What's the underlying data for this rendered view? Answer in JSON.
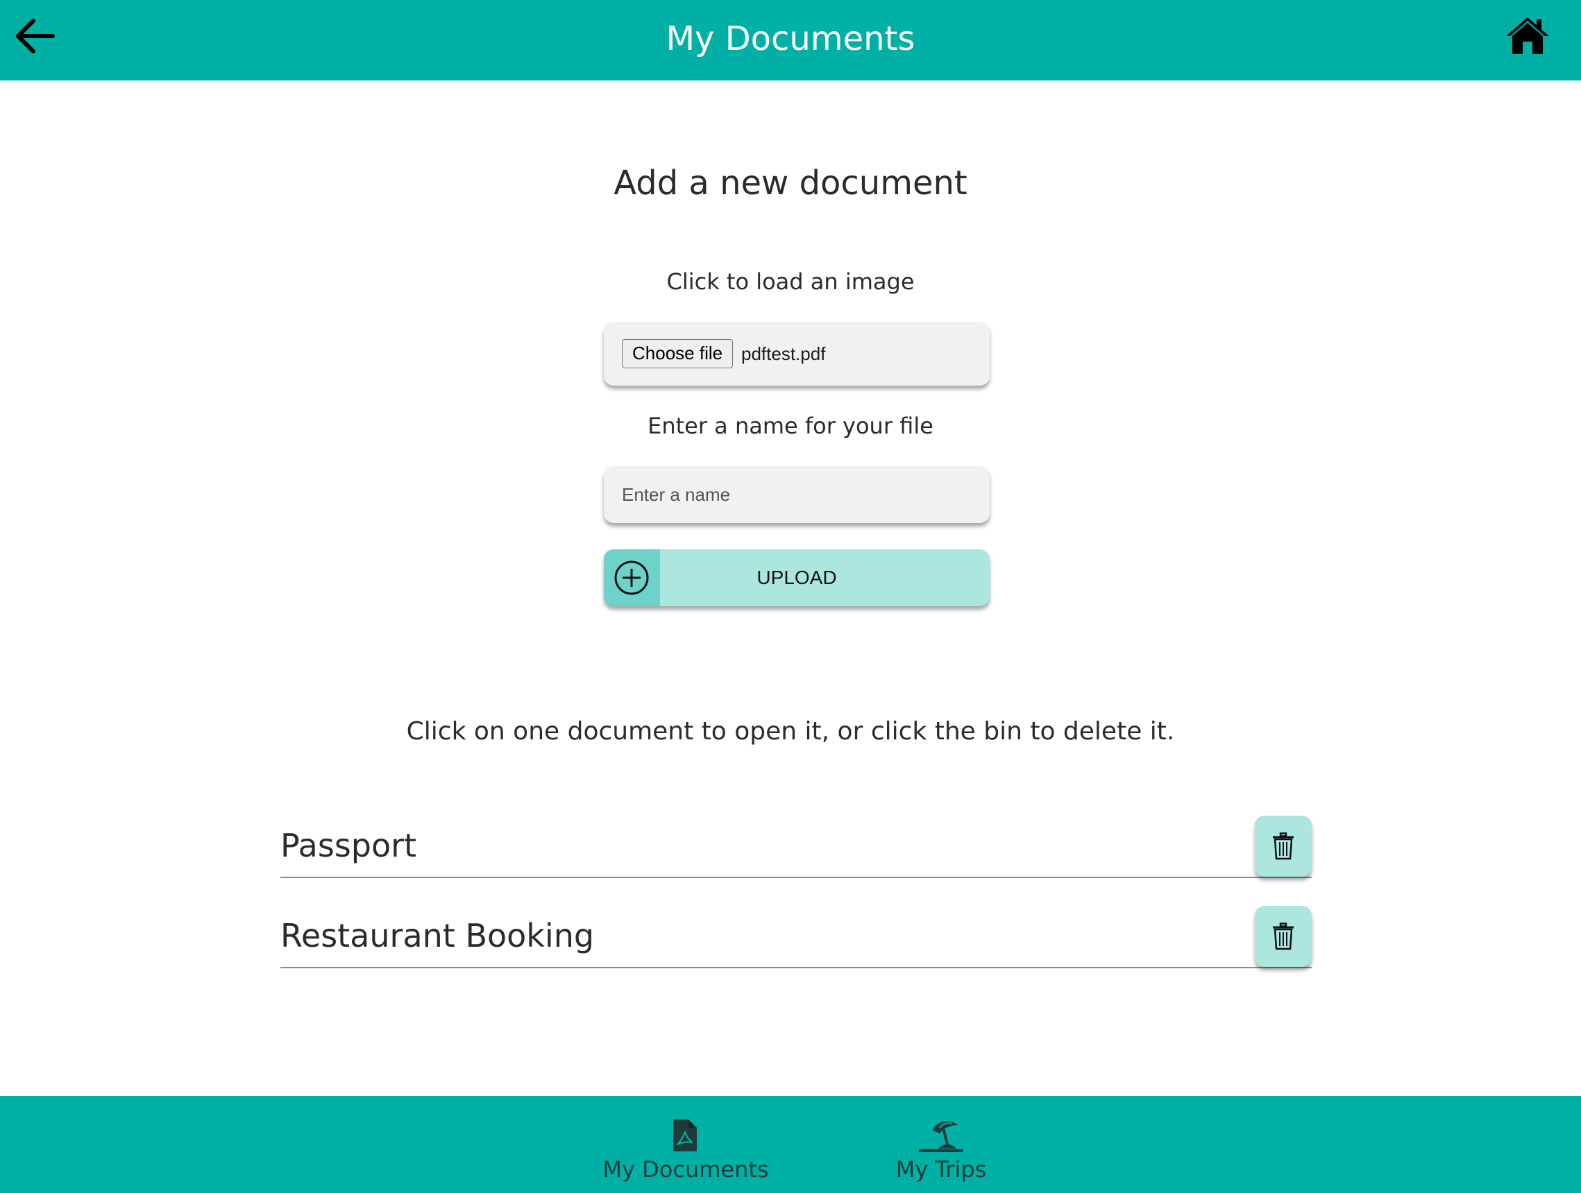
{
  "header": {
    "title": "My Documents",
    "back_icon": "arrow-left-icon",
    "home_icon": "home-icon",
    "background": "#00b0a4"
  },
  "form": {
    "heading": "Add a new document",
    "load_label": "Click to load an image",
    "choose_file_label": "Choose file",
    "selected_file": "pdftest.pdf",
    "name_label": "Enter a name for your file",
    "name_value": "",
    "name_placeholder": "Enter a name",
    "upload_label": "UPLOAD",
    "upload_icon": "plus-circle-icon",
    "accent_light": "#abe6df",
    "accent_mid": "#6dd3ca"
  },
  "instructions": "Click on one document to open it, or click the bin to delete it.",
  "documents": [
    {
      "name": "Passport",
      "delete_icon": "trash-icon"
    },
    {
      "name": "Restaurant Booking",
      "delete_icon": "trash-icon"
    }
  ],
  "footer": {
    "tabs": [
      {
        "label": "My Documents",
        "icon": "pdf-file-icon"
      },
      {
        "label": "My Trips",
        "icon": "beach-umbrella-icon"
      }
    ]
  }
}
